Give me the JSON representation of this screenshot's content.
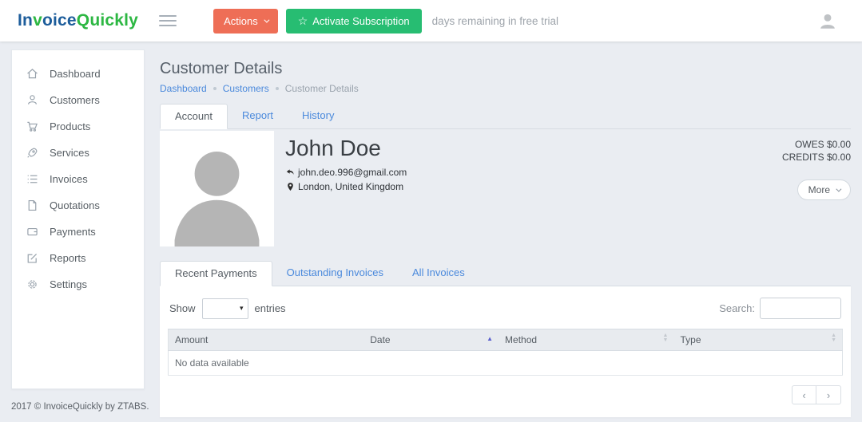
{
  "header": {
    "logo": {
      "part1": "In",
      "part2": "v",
      "part3": "oice",
      "part4": "Quickly"
    },
    "actions_label": "Actions",
    "activate_label": "Activate Subscription",
    "trial_text": "days remaining in free trial"
  },
  "sidebar": {
    "items": [
      {
        "label": "Dashboard",
        "icon": "home-icon"
      },
      {
        "label": "Customers",
        "icon": "person-icon"
      },
      {
        "label": "Products",
        "icon": "cart-icon"
      },
      {
        "label": "Services",
        "icon": "rocket-icon"
      },
      {
        "label": "Invoices",
        "icon": "list-icon"
      },
      {
        "label": "Quotations",
        "icon": "document-icon"
      },
      {
        "label": "Payments",
        "icon": "wallet-icon"
      },
      {
        "label": "Reports",
        "icon": "edit-icon"
      },
      {
        "label": "Settings",
        "icon": "gear-icon"
      }
    ]
  },
  "page": {
    "title": "Customer Details",
    "breadcrumb": [
      "Dashboard",
      "Customers",
      "Customer Details"
    ],
    "tabs": [
      {
        "label": "Account",
        "active": true
      },
      {
        "label": "Report",
        "active": false
      },
      {
        "label": "History",
        "active": false
      }
    ]
  },
  "customer": {
    "name": "John Doe",
    "email": "john.deo.996@gmail.com",
    "location": "London, United Kingdom",
    "owes": "OWES $0.00",
    "credits": "CREDITS $0.00",
    "more_label": "More"
  },
  "subtabs": [
    {
      "label": "Recent Payments",
      "active": true
    },
    {
      "label": "Outstanding Invoices",
      "active": false
    },
    {
      "label": "All Invoices",
      "active": false
    }
  ],
  "table": {
    "show_label": "Show",
    "entries_label": "entries",
    "search_label": "Search:",
    "headers": [
      {
        "label": "Amount",
        "sort": "none"
      },
      {
        "label": "Date",
        "sort": "asc"
      },
      {
        "label": "Method",
        "sort": "both"
      },
      {
        "label": "Type",
        "sort": "both"
      }
    ],
    "empty_text": "No data available"
  },
  "icons": {
    "star": "☆",
    "sort_asc": "▲",
    "sort_up": "▲",
    "sort_down": "▼",
    "select_caret": "▾",
    "prev": "‹",
    "next": "›"
  },
  "colors": {
    "accent_blue": "#4a89dc",
    "brand_blue": "#1d5d9b",
    "brand_green": "#2cb742",
    "danger": "#ee6e56",
    "success": "#27bd72",
    "page_bg": "#eaedf2"
  },
  "footer": {
    "text": "2017 © InvoiceQuickly by ZTABS."
  }
}
